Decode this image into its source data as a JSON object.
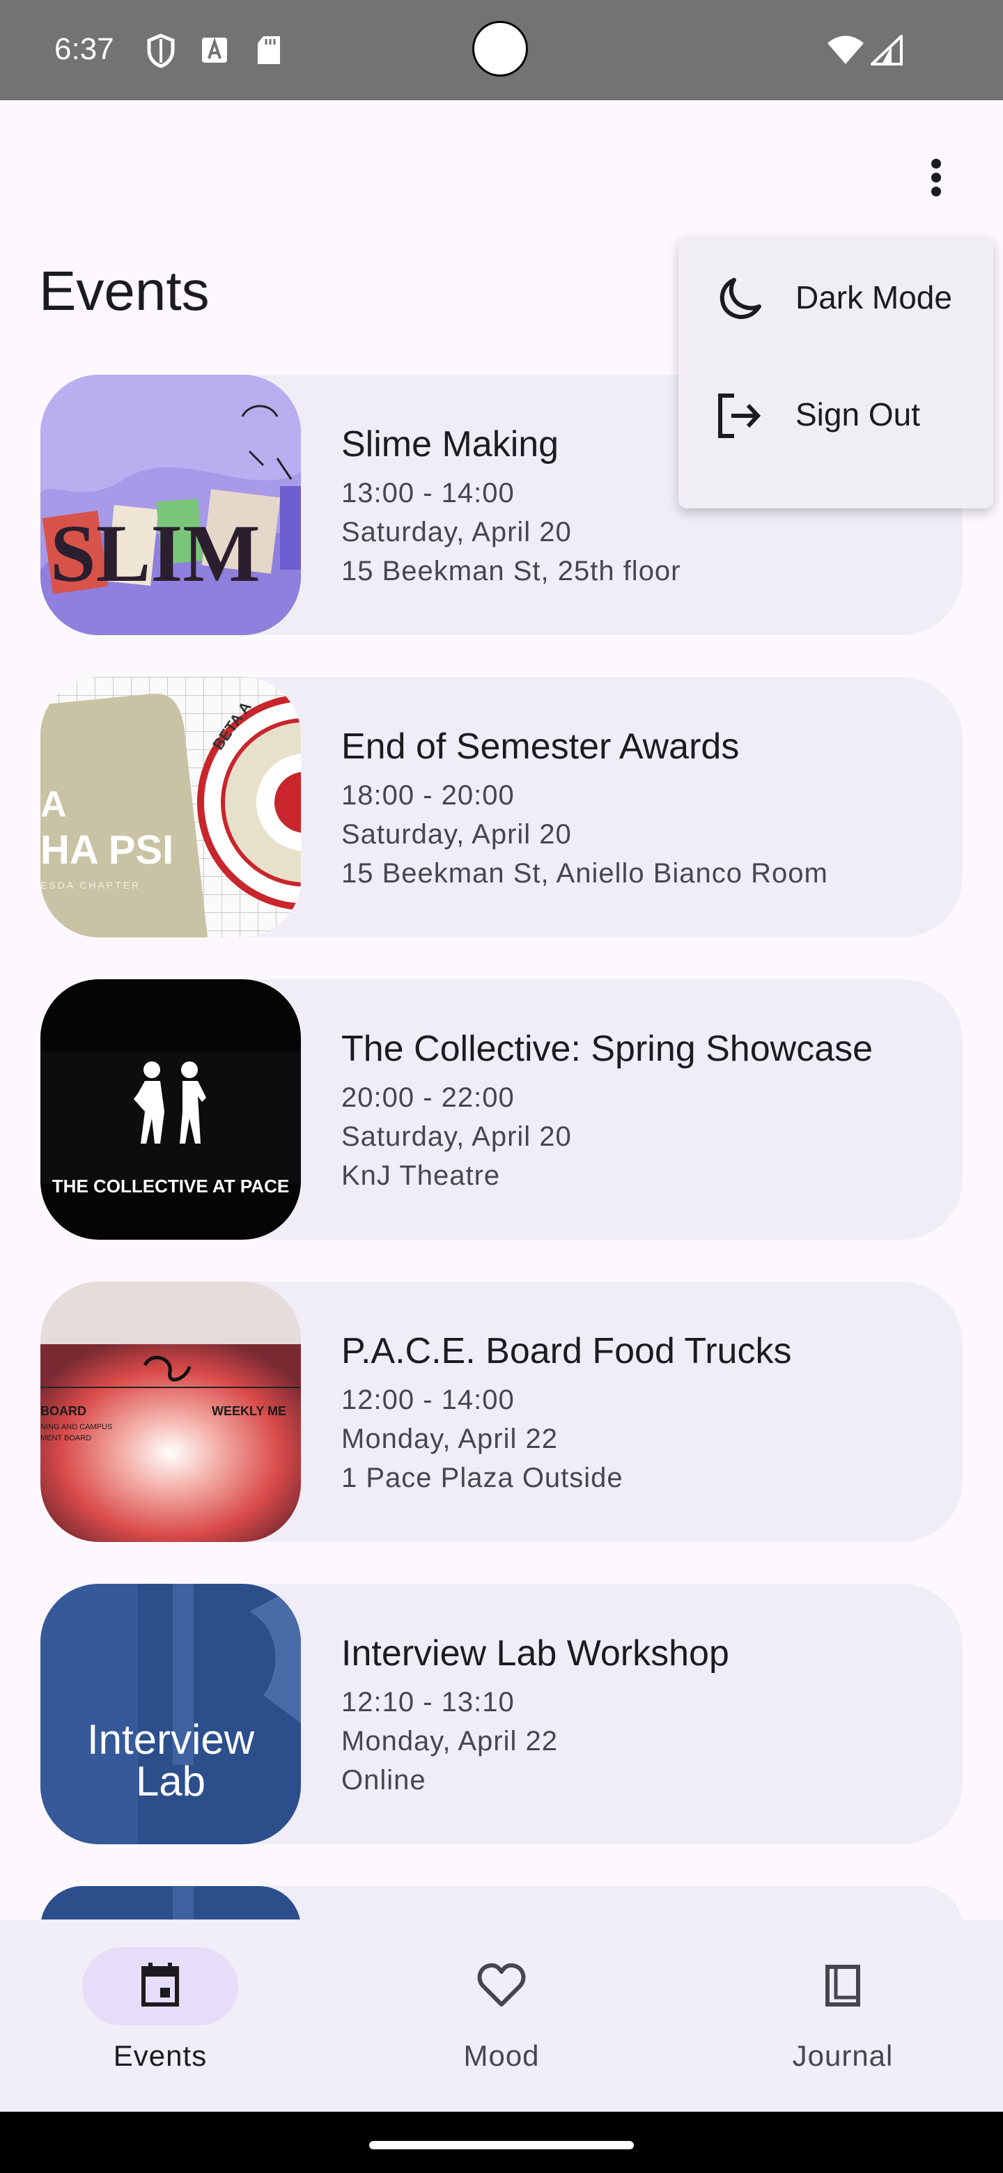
{
  "status_bar": {
    "time": "6:37",
    "icons": [
      "shield-icon",
      "font-a-icon",
      "sd-card-icon",
      "wifi-icon",
      "signal-icon"
    ]
  },
  "page": {
    "title": "Events"
  },
  "menu": {
    "items": [
      {
        "label": "Dark Mode",
        "icon": "moon-icon"
      },
      {
        "label": "Sign Out",
        "icon": "logout-icon"
      }
    ]
  },
  "events": [
    {
      "title": "Slime Making",
      "time": "13:00 - 14:00",
      "date": "Saturday, April 20",
      "location": "15 Beekman St, 25th floor",
      "image": "slime-poster"
    },
    {
      "title": "End of Semester Awards",
      "time": "18:00 - 20:00",
      "date": "Saturday, April 20",
      "location": "15 Beekman St, Aniello Bianco Room",
      "image": "awards-poster"
    },
    {
      "title": "The Collective: Spring Showcase",
      "time": "20:00 - 22:00",
      "date": "Saturday, April 20",
      "location": "KnJ Theatre",
      "image": "collective-poster"
    },
    {
      "title": "P.A.C.E. Board Food Trucks",
      "time": "12:00 - 14:00",
      "date": "Monday, April 22",
      "location": "1 Pace Plaza Outside",
      "image": "pace-board-poster"
    },
    {
      "title": "Interview Lab Workshop",
      "time": "12:10 - 13:10",
      "date": "Monday, April 22",
      "location": "Online",
      "image": "interview-lab-poster"
    }
  ],
  "posters": {
    "slime": "SLIM",
    "awards_left": "A",
    "awards_main": "HA PSI",
    "awards_sub": "ESDA CHAPTER",
    "awards_seal": "BETA A",
    "collective": "THE COLLECTIVE AT PACE",
    "pace_left": "BOARD",
    "pace_left_2": "NING AND CAMPUS",
    "pace_left_3": "MENT BOARD",
    "pace_right": "WEEKLY ME",
    "interview_1": "Interview",
    "interview_2": "Lab"
  },
  "bottom_nav": {
    "items": [
      {
        "label": "Events",
        "icon": "calendar-icon",
        "active": true
      },
      {
        "label": "Mood",
        "icon": "heart-icon",
        "active": false
      },
      {
        "label": "Journal",
        "icon": "book-icon",
        "active": false
      }
    ]
  },
  "colors": {
    "background": "#fdf8fd",
    "card": "#f0edf7",
    "active_pill": "#e6ddf8",
    "status_bar": "#737373"
  }
}
